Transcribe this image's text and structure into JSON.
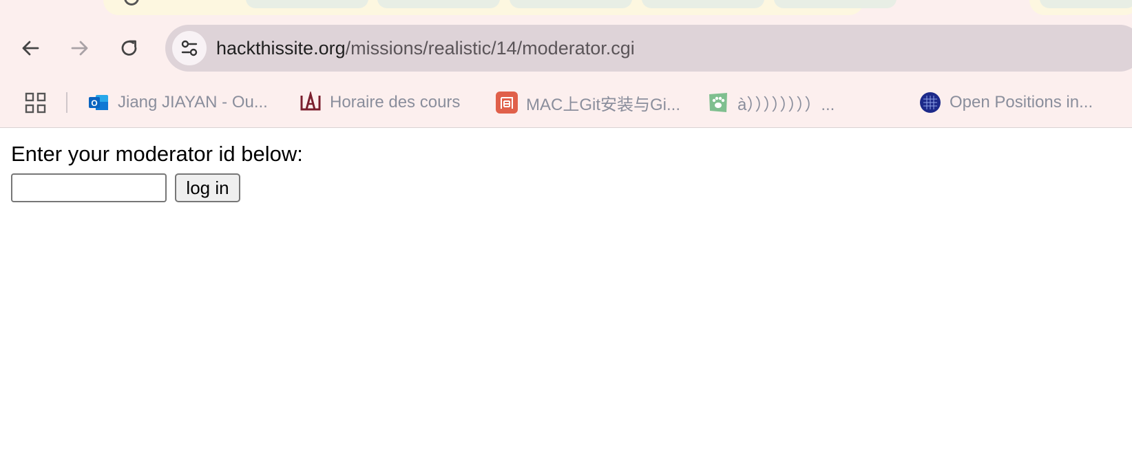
{
  "browser": {
    "url_host": "hackthissite.org",
    "url_path": "/missions/realistic/14/moderator.cgi",
    "nav": {
      "back_icon": "arrow-left-icon",
      "forward_icon": "arrow-right-icon",
      "reload_icon": "reload-icon",
      "site_info_icon": "tune-icon"
    },
    "bookmarks": [
      {
        "label": "Jiang JIAYAN - Ou...",
        "icon": "outlook-icon",
        "color": "#1a73e8"
      },
      {
        "label": "Horaire des cours",
        "icon": "university-logo-icon",
        "color": "#7a1f2e"
      },
      {
        "label": "MAC上Git安装与Gi...",
        "icon": "jianshu-icon",
        "color": "#e0604a"
      },
      {
        "label": "à））））））））...",
        "icon": "paw-icon",
        "color": "#7fbf8f"
      },
      {
        "label": "Open Positions in...",
        "icon": "globe-grid-icon",
        "color": "#1d2a8a"
      }
    ]
  },
  "page": {
    "prompt": "Enter your moderator id below:",
    "moderator_id": {
      "value": "",
      "placeholder": ""
    },
    "login_button": "log in"
  }
}
